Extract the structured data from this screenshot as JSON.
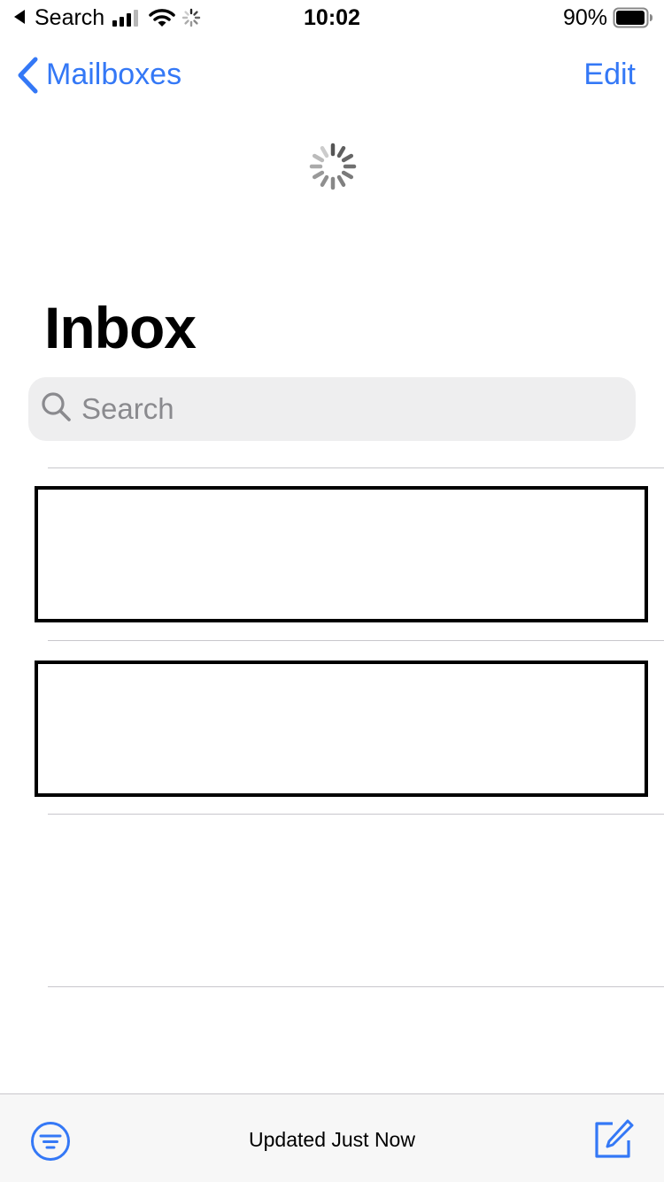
{
  "status_bar": {
    "back_app_label": "Search",
    "time": "10:02",
    "battery_percent": "90%"
  },
  "nav": {
    "back_label": "Mailboxes",
    "edit_label": "Edit"
  },
  "page": {
    "title": "Inbox"
  },
  "search": {
    "placeholder": "Search",
    "value": ""
  },
  "toolbar": {
    "status_text": "Updated Just Now"
  },
  "icons": {
    "status_back": "back-triangle-icon",
    "signal": "cellular-signal-icon",
    "wifi": "wifi-icon",
    "activity": "activity-spinner-icon",
    "battery": "battery-icon",
    "nav_back": "chevron-left-icon",
    "loading": "loading-spinner-icon",
    "search": "magnifying-glass-icon",
    "filter": "filter-icon",
    "compose": "compose-icon"
  },
  "colors": {
    "accent": "#3478f6",
    "search_bg": "#eeeeef",
    "toolbar_bg": "#f7f7f7",
    "separator": "#c8c7cc",
    "placeholder": "#8a8a8e"
  }
}
